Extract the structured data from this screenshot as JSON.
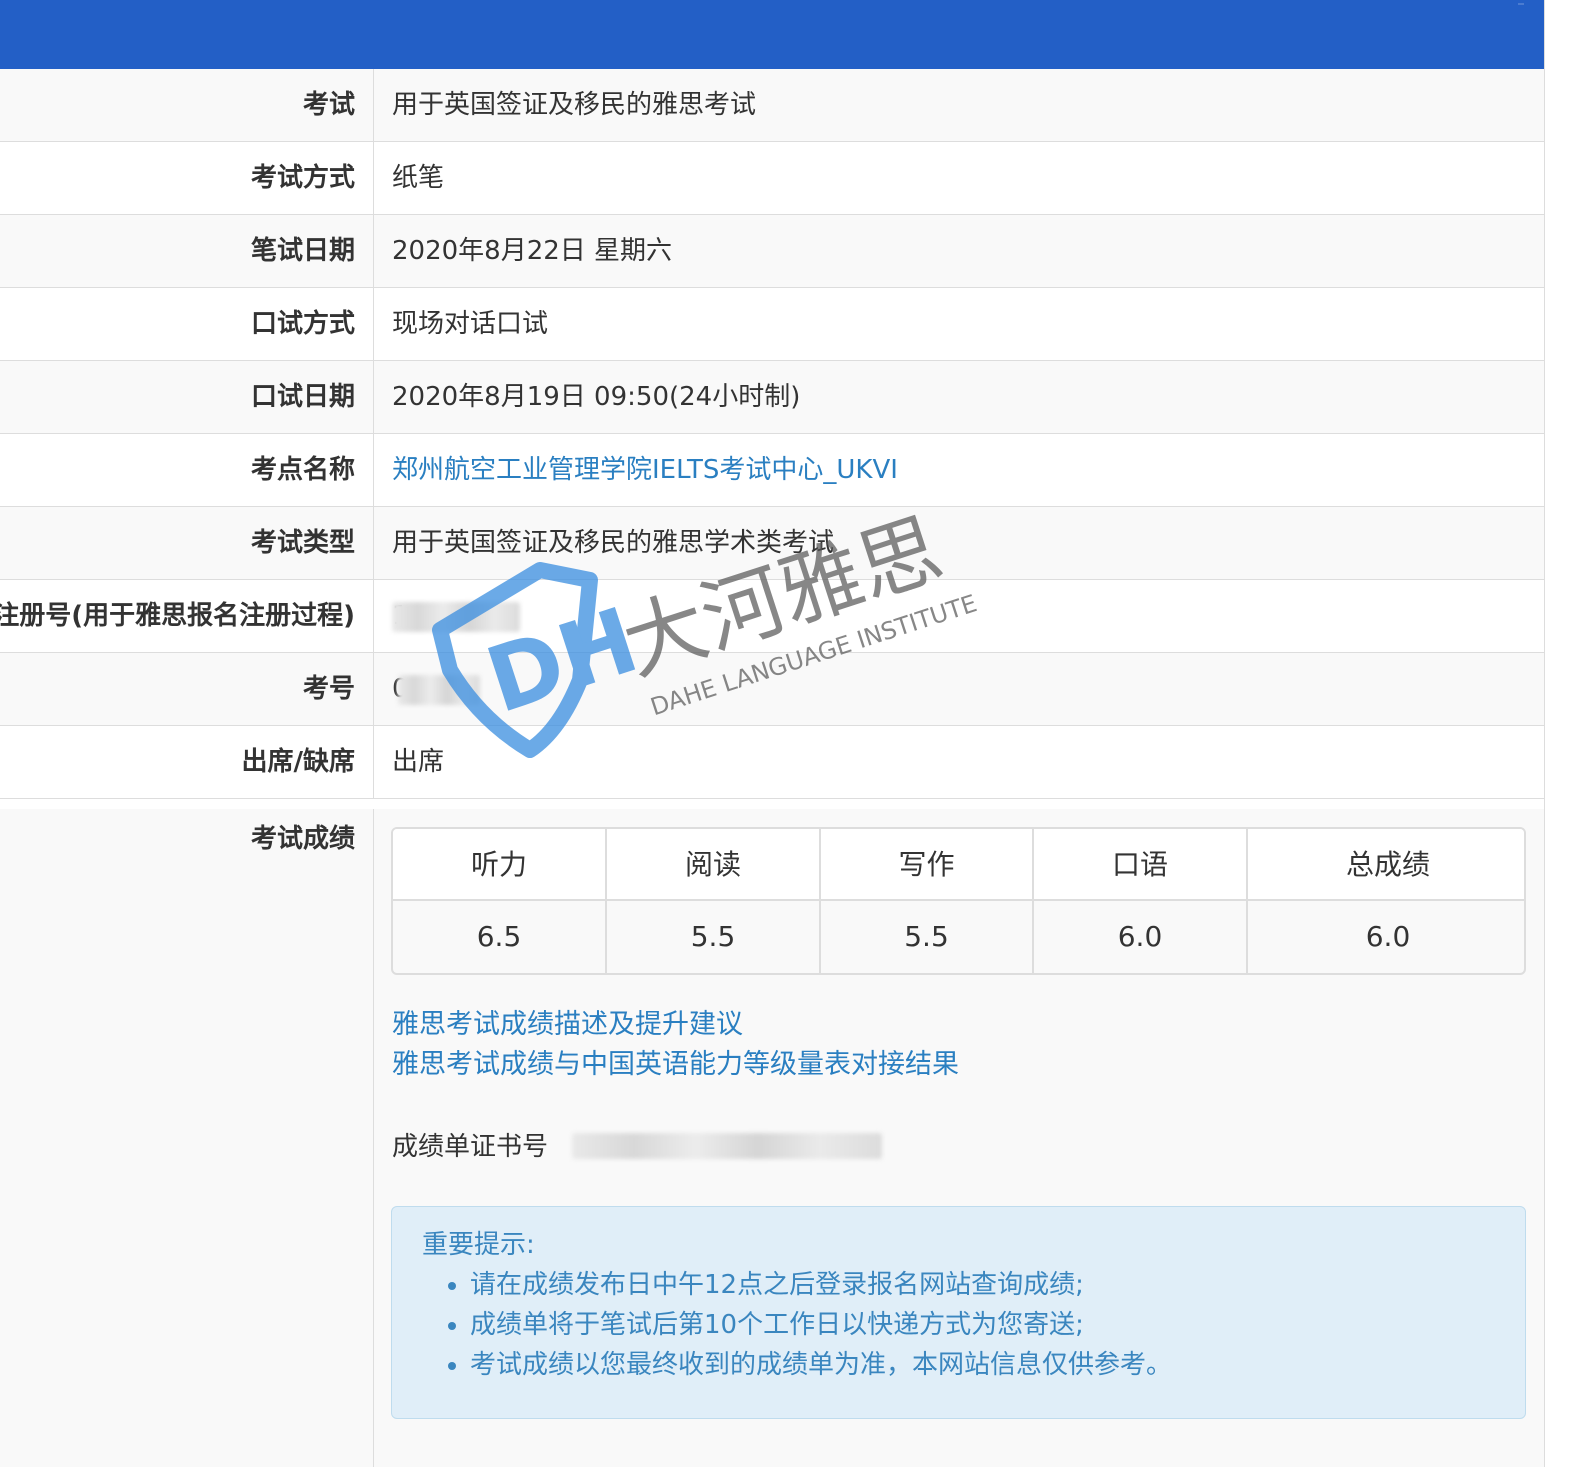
{
  "rows": [
    {
      "label": "考试",
      "value": "用于英国签证及移民的雅思考试"
    },
    {
      "label": "考试方式",
      "value": "纸笔"
    },
    {
      "label": "笔试日期",
      "value": "2020年8月22日 星期六"
    },
    {
      "label": "口试方式",
      "value": "现场对话口试"
    },
    {
      "label": "口试日期",
      "value": "2020年8月19日 09:50(24小时制)"
    },
    {
      "label": "考点名称",
      "value": "郑州航空工业管理学院IELTS考试中心_UKVI"
    },
    {
      "label": "考试类型",
      "value": "用于英国签证及移民的雅思学术类考试"
    },
    {
      "label": "注册号(用于雅思报名注册过程)",
      "value": "1"
    },
    {
      "label": "考号",
      "value": "0"
    },
    {
      "label": "出席/缺席",
      "value": "出席"
    }
  ],
  "scores": {
    "label": "考试成绩",
    "headers": [
      "听力",
      "阅读",
      "写作",
      "口语",
      "总成绩"
    ],
    "values": [
      "6.5",
      "5.5",
      "5.5",
      "6.0",
      "6.0"
    ]
  },
  "links": [
    "雅思考试成绩描述及提升建议",
    "雅思考试成绩与中国英语能力等级量表对接结果"
  ],
  "certificate_label": "成绩单证书号",
  "notice": {
    "title": "重要提示:",
    "items": [
      "请在成绩发布日中午12点之后登录报名网站查询成绩;",
      "成绩单将于笔试后第10个工作日以快递方式为您寄送;",
      "考试成绩以您最终收到的成绩单为准，本网站信息仅供参考。"
    ]
  },
  "watermark": {
    "cn": "大河雅思",
    "en": "DAHE LANGUAGE INSTITUTE"
  },
  "colors": {
    "header": "#235fc6",
    "link": "#2a7fc1",
    "notice_bg": "#e0eef8",
    "notice_text": "#3a86bf"
  }
}
